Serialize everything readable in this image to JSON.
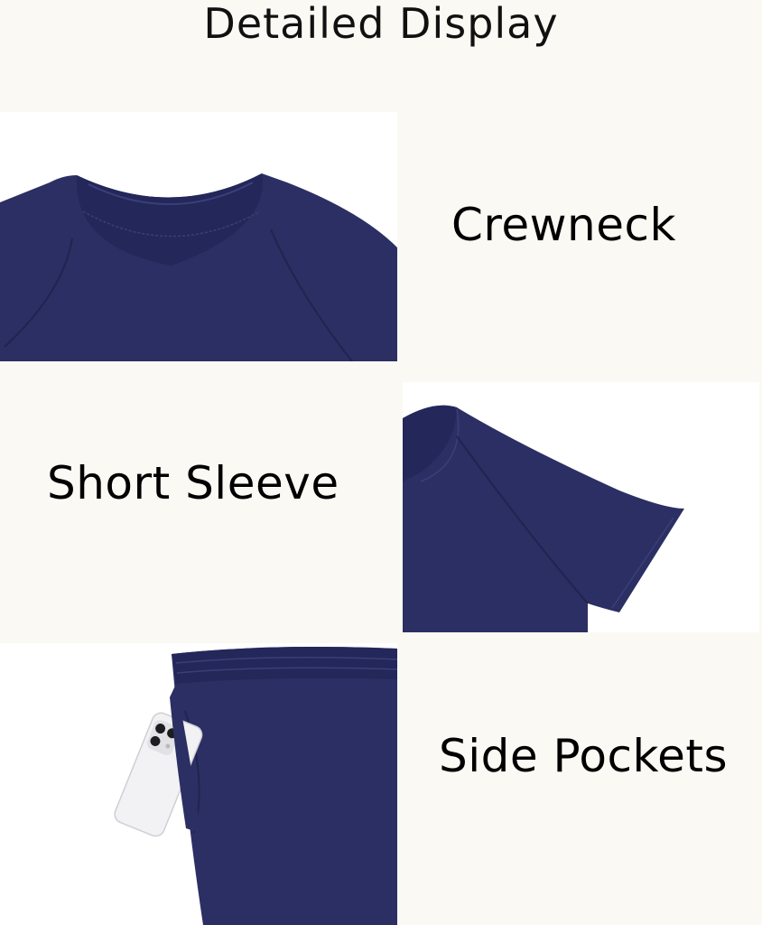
{
  "page": {
    "title": "Detailed Display",
    "background_color": "#fbf9f3",
    "garment_color": "#2b2f63"
  },
  "features": [
    {
      "label": "Crewneck",
      "image": "navy-tshirt-crewneck-closeup"
    },
    {
      "label": "Short Sleeve",
      "image": "navy-tshirt-short-sleeve-closeup"
    },
    {
      "label": "Side Pockets",
      "image": "navy-shorts-pocket-with-phone"
    }
  ]
}
